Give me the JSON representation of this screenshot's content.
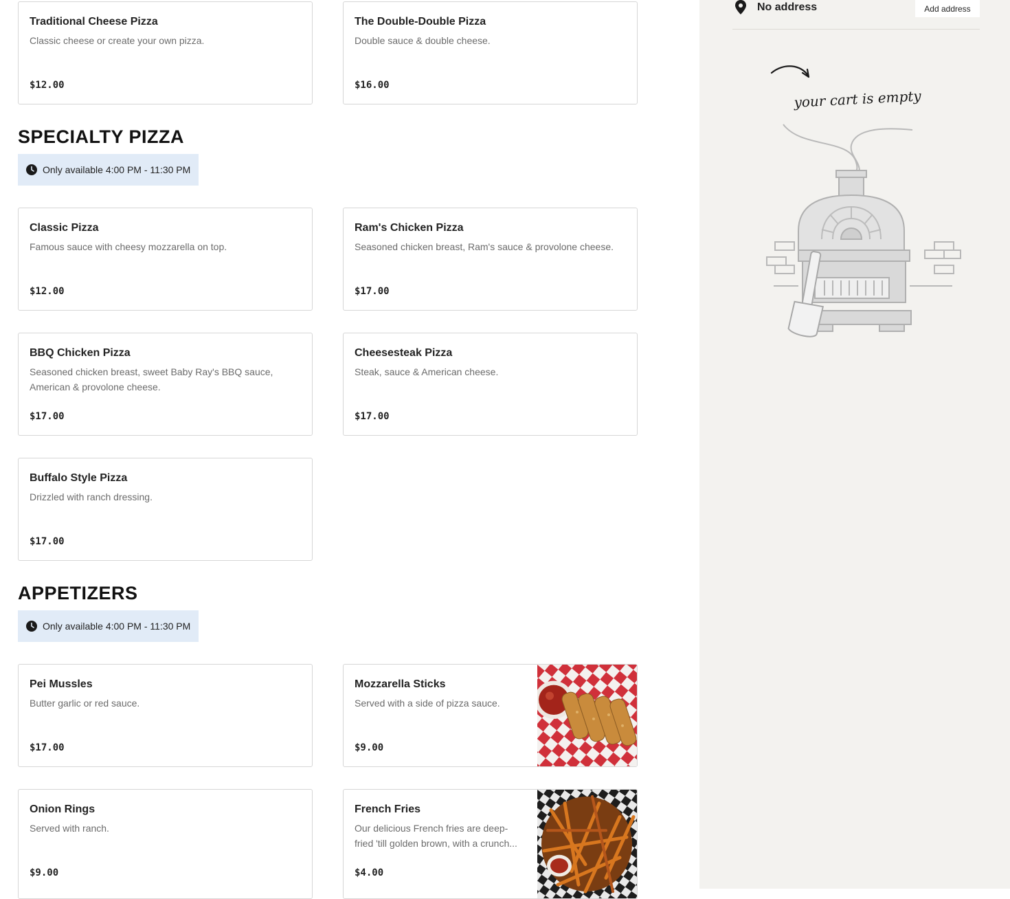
{
  "sections": {
    "specialty": {
      "title": "SPECIALTY PIZZA",
      "availability": "Only available 4:00 PM - 11:30 PM"
    },
    "appetizers": {
      "title": "APPETIZERS",
      "availability": "Only available 4:00 PM - 11:30 PM"
    }
  },
  "items": {
    "traditional_cheese": {
      "name": "Traditional Cheese Pizza",
      "description": "Classic cheese or create your own pizza.",
      "price": "$12.00"
    },
    "double_double": {
      "name": "The Double-Double Pizza",
      "description": "Double sauce & double cheese.",
      "price": "$16.00"
    },
    "classic": {
      "name": "Classic Pizza",
      "description": "Famous sauce with cheesy mozzarella on top.",
      "price": "$12.00"
    },
    "rams_chicken": {
      "name": "Ram's Chicken Pizza",
      "description": "Seasoned chicken breast, Ram's sauce & provolone cheese.",
      "price": "$17.00"
    },
    "bbq_chicken": {
      "name": "BBQ Chicken Pizza",
      "description": "Seasoned chicken breast, sweet Baby Ray's BBQ sauce, American & provolone cheese.",
      "price": "$17.00"
    },
    "cheesesteak": {
      "name": "Cheesesteak Pizza",
      "description": "Steak, sauce & American cheese.",
      "price": "$17.00"
    },
    "buffalo": {
      "name": "Buffalo Style Pizza",
      "description": "Drizzled with ranch dressing.",
      "price": "$17.00"
    },
    "pei_mussels": {
      "name": "Pei Mussles",
      "description": "Butter garlic or red sauce.",
      "price": "$17.00"
    },
    "mozzarella_sticks": {
      "name": "Mozzarella Sticks",
      "description": "Served with a side of pizza sauce.",
      "price": "$9.00"
    },
    "onion_rings": {
      "name": "Onion Rings",
      "description": "Served with ranch.",
      "price": "$9.00"
    },
    "french_fries": {
      "name": "French Fries",
      "description": "Our delicious French fries are deep-fried 'till golden brown, with a crunch...",
      "price": "$4.00"
    }
  },
  "sidebar": {
    "address_label": "No address",
    "add_address_button": "Add address",
    "empty_cart_text": "your cart is empty"
  },
  "icons": {
    "clock": "clock-icon",
    "pin": "location-pin-icon"
  },
  "colors": {
    "availability_bg": "#e1ebf7",
    "sidebar_bg": "#f3f2ef",
    "card_border": "#d6d6d6"
  }
}
